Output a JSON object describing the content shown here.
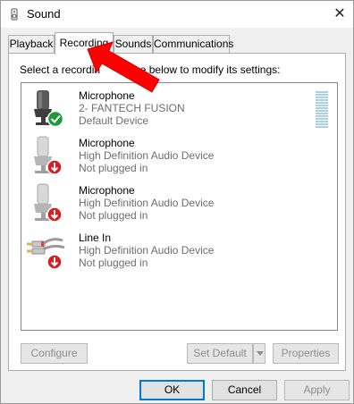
{
  "window": {
    "title": "Sound",
    "close_glyph": "✕",
    "title_icon": "speaker-icon"
  },
  "tabs": [
    {
      "label": "Playback",
      "active": false
    },
    {
      "label": "Recording",
      "active": true
    },
    {
      "label": "Sounds",
      "active": false
    },
    {
      "label": "Communications",
      "active": false
    }
  ],
  "recording": {
    "instruction_visible": "Select a recordin",
    "instruction_visible_end": "vice below to modify its settings:",
    "devices": [
      {
        "name": "Microphone",
        "detail": "2- FANTECH FUSION",
        "status": "Default Device",
        "icon": "microphone-icon",
        "badge": "check-icon",
        "state": "default"
      },
      {
        "name": "Microphone",
        "detail": "High Definition Audio Device",
        "status": "Not plugged in",
        "icon": "microphone-icon",
        "badge": "down-arrow-icon",
        "state": "unplugged"
      },
      {
        "name": "Microphone",
        "detail": "High Definition Audio Device",
        "status": "Not plugged in",
        "icon": "microphone-icon",
        "badge": "down-arrow-icon",
        "state": "unplugged"
      },
      {
        "name": "Line In",
        "detail": "High Definition Audio Device",
        "status": "Not plugged in",
        "icon": "line-in-cable-icon",
        "badge": "down-arrow-icon",
        "state": "unplugged"
      }
    ],
    "level_meter_fraction": 0
  },
  "panel_buttons": {
    "configure": "Configure",
    "set_default": "Set Default",
    "properties": "Properties"
  },
  "dialog_buttons": {
    "ok": "OK",
    "cancel": "Cancel",
    "apply": "Apply"
  },
  "colors": {
    "accent": "#0078d7",
    "annotation_arrow": "#ff0000",
    "check_badge": "#1e9a3c",
    "unplugged_badge": "#d81e1e"
  }
}
